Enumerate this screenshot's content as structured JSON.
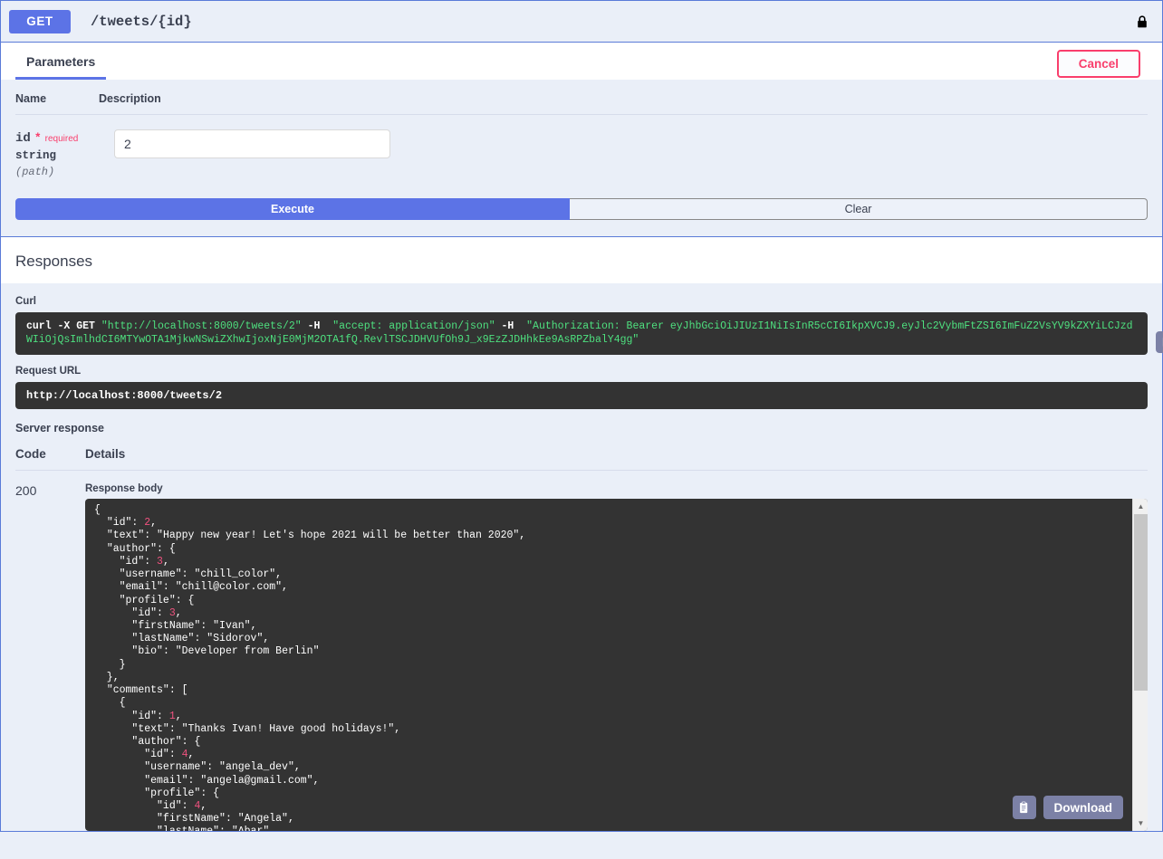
{
  "operation": {
    "method": "GET",
    "path": "/tweets/{id}",
    "lock_icon": "lock-icon"
  },
  "tabs": [
    {
      "label": "Parameters",
      "active": true
    }
  ],
  "cancel_label": "Cancel",
  "parameters": {
    "headers": {
      "name": "Name",
      "description": "Description"
    },
    "rows": [
      {
        "name": "id",
        "required_star": "*",
        "required_text": "required",
        "type": "string",
        "location": "(path)",
        "value": "2",
        "placeholder": "id"
      }
    ]
  },
  "buttons": {
    "execute": "Execute",
    "clear": "Clear"
  },
  "responses": {
    "section_title": "Responses",
    "curl_label": "Curl",
    "curl_command": "curl -X GET \"http://localhost:8000/tweets/2\" -H  \"accept: application/json\" -H  \"Authorization: Bearer eyJhbGciOiJIUzI1NiIsInR5cCI6IkpXVCJ9.eyJlc2VybmFtZSI6ImFuZ2VsYV9kZXYiLCJzdWIiOjQsImlhdCI6MTYwOTA1MjkwNSwiZXhwIjoxNjE0MjM2OTA1fQ.RevlTSCJDHVUfOh9J_x9EzZJDHhkEe9AsRPZbalY4gg\"",
    "curl_prefix": "curl -X GET ",
    "curl_url": "\"http://localhost:8000/tweets/2\"",
    "curl_h1_flag": " -H  ",
    "curl_h1": "\"accept: application/json\"",
    "curl_h2_flag": " -H  ",
    "curl_h2": "\"Authorization: Bearer eyJhbGciOiJIUzI1NiIsInR5cCI6IkpXVCJ9.eyJlc2VybmFtZSI6ImFuZ2VsYV9kZXYiLCJzdWIiOjQsImlhdCI6MTYwOTA1MjkwNSwiZXhwIjoxNjE0MjM2OTA1fQ.RevlTSCJDHVUfOh9J_x9EzZJDHhkEe9AsRPZbalY4gg\"",
    "copy_curl_icon": "copy-to-clipboard-icon",
    "request_url_label": "Request URL",
    "request_url": "http://localhost:8000/tweets/2",
    "server_response_label": "Server response",
    "table_headers": {
      "code": "Code",
      "details": "Details"
    },
    "response_code": "200",
    "response_body_label": "Response body",
    "response_body": "{\n  \"id\": 2,\n  \"text\": \"Happy new year! Let's hope 2021 will be better than 2020\",\n  \"author\": {\n    \"id\": 3,\n    \"username\": \"chill_color\",\n    \"email\": \"chill@color.com\",\n    \"profile\": {\n      \"id\": 3,\n      \"firstName\": \"Ivan\",\n      \"lastName\": \"Sidorov\",\n      \"bio\": \"Developer from Berlin\"\n    }\n  },\n  \"comments\": [\n    {\n      \"id\": 1,\n      \"text\": \"Thanks Ivan! Have good holidays!\",\n      \"author\": {\n        \"id\": 4,\n        \"username\": \"angela_dev\",\n        \"email\": \"angela@gmail.com\",\n        \"profile\": {\n          \"id\": 4,\n          \"firstName\": \"Angela\",\n          \"lastName\": \"Abar\",\n          \"bio\": \"Backend developer from Germany\"",
    "copy_response_icon": "copy-to-clipboard-icon",
    "download_label": "Download",
    "scrollbar_up_icon": "triangle-up-icon",
    "scrollbar_down_icon": "triangle-down-icon"
  },
  "colors": {
    "method_get": "#5c73e6",
    "accent": "#5c73e6",
    "cancel": "#f93e6c",
    "panel_bg": "#eaeff8",
    "code_bg": "#333333",
    "json_string": "#4ee07f",
    "json_number": "#f0527f",
    "button_grey": "#7c81a6"
  }
}
